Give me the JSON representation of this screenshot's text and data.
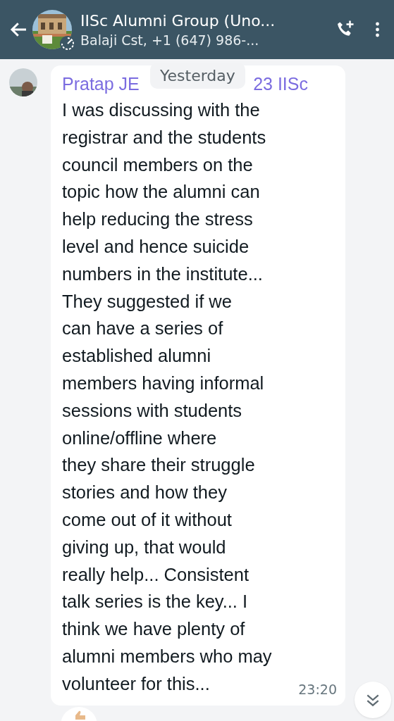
{
  "header": {
    "title": "IISc Alumni Group (Uno...",
    "subtitle": "Balaji Cst, +1 (647) 986-..."
  },
  "date_pill": "Yesterday",
  "message": {
    "sender_start": "Pratap JE",
    "sender_end": "23 IISc",
    "text": "I was discussing with the\nregistrar and the students\ncouncil members on the\ntopic how the alumni can\nhelp reducing the stress\nlevel and hence suicide\nnumbers in the institute...\nThey suggested if we\ncan have a series of\nestablished alumni\nmembers having informal\nsessions with students\nonline/offline where\nthey share their struggle\nstories and how they\ncome out of it without\ngiving up, that would\nreally help... Consistent\ntalk series is the key... I\nthink we have plenty of\nalumni members who may\nvolunteer for this...",
    "time": "23:20"
  }
}
